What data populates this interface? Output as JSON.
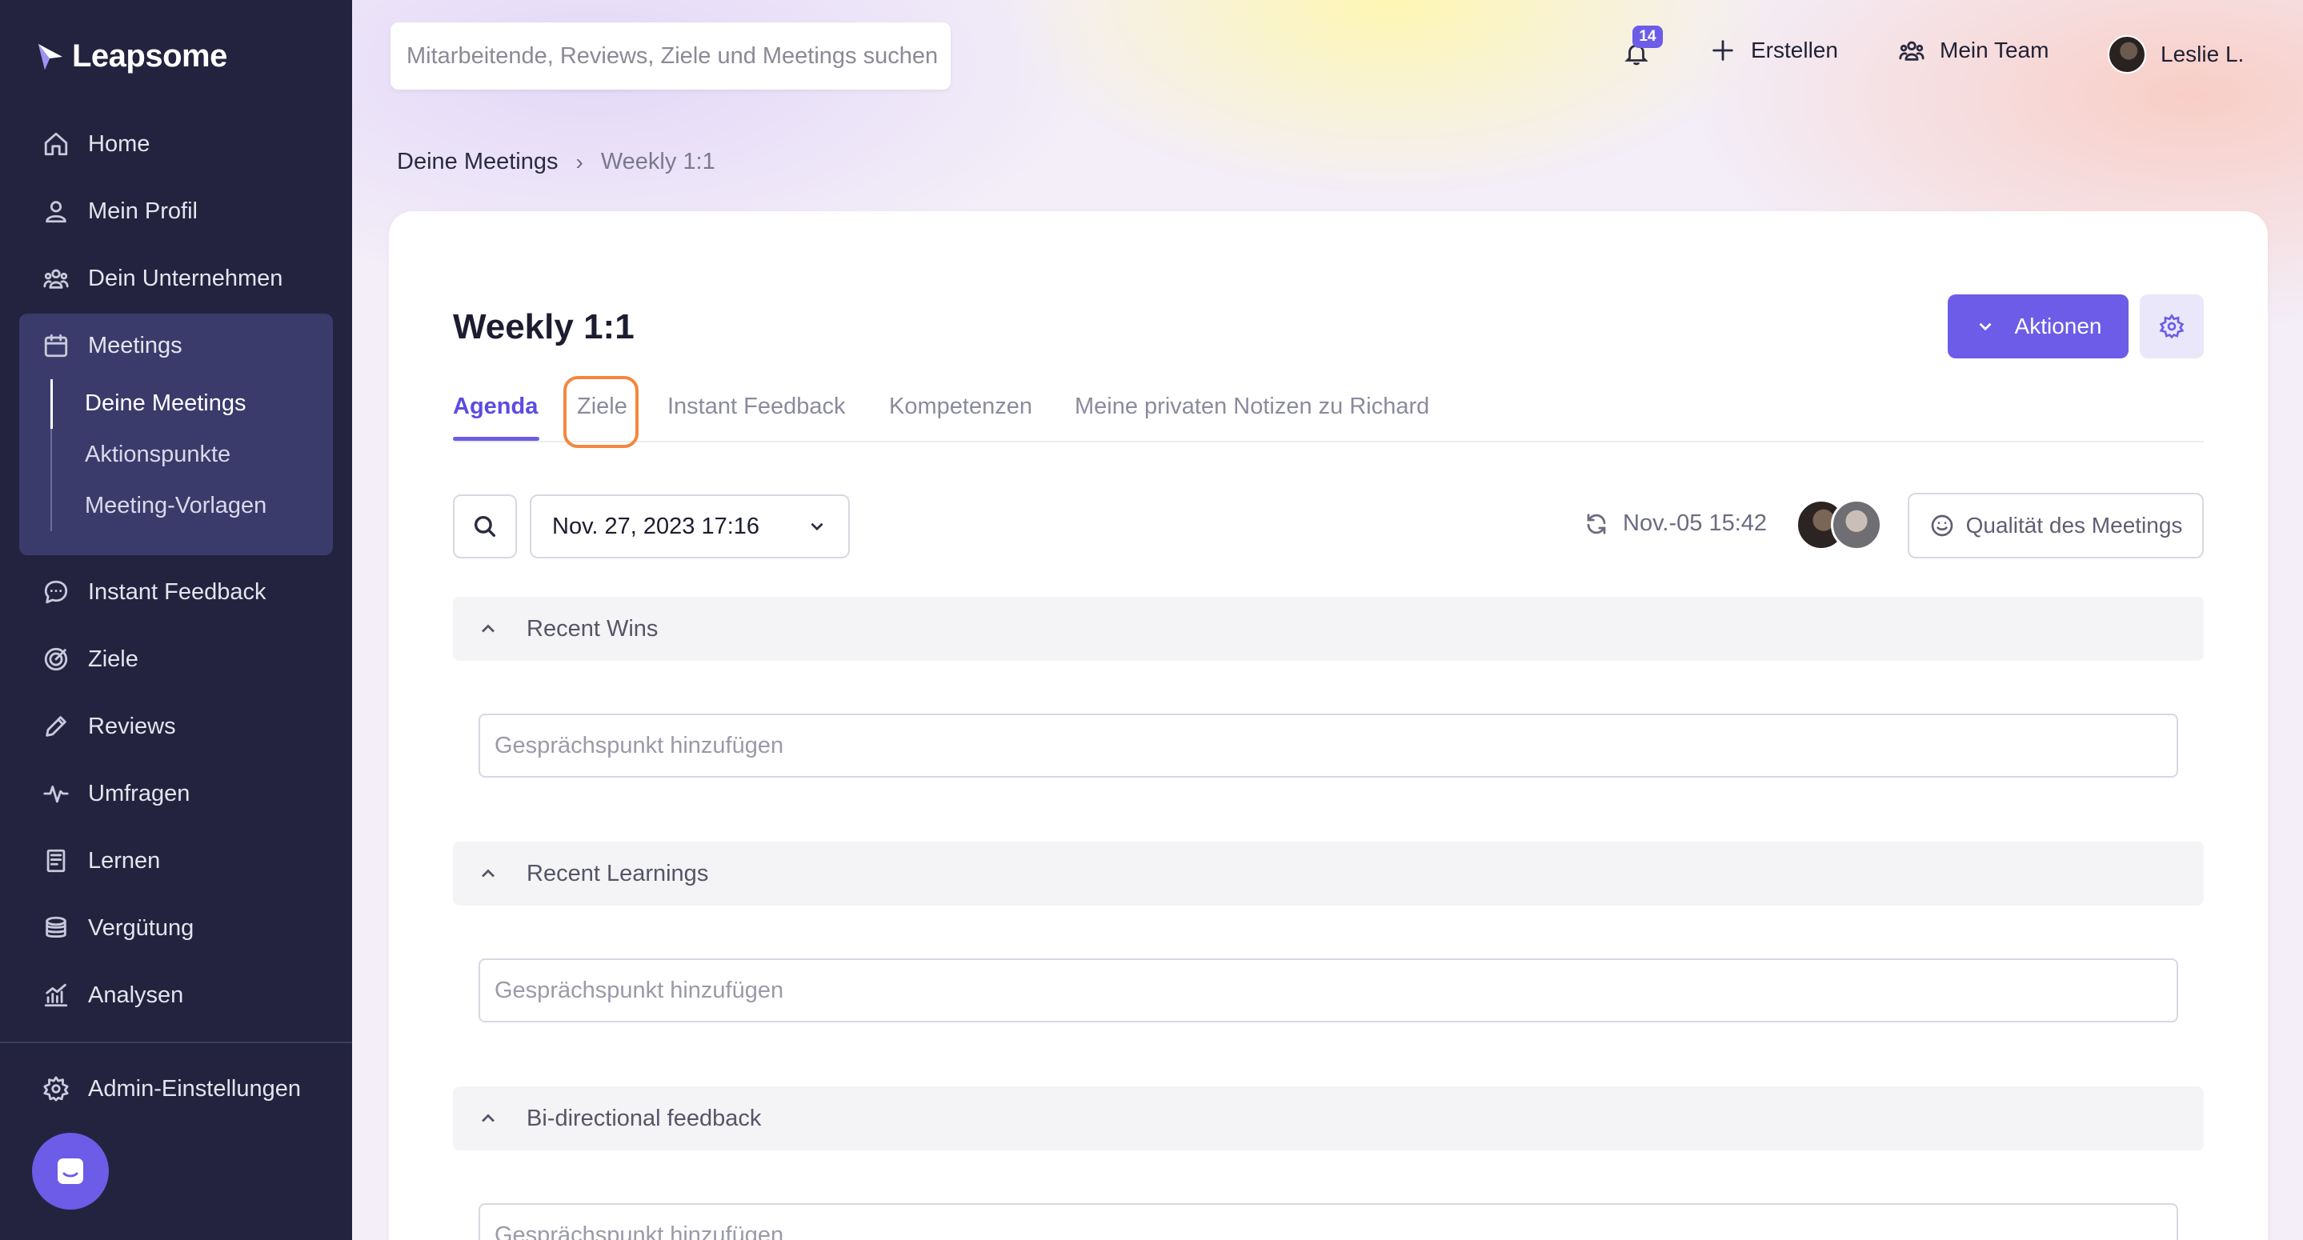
{
  "brand": {
    "name": "Leapsome",
    "accent": "#6c5ce7",
    "sidebar_bg": "#23233f"
  },
  "sidebar": {
    "items": [
      {
        "label": "Home",
        "icon": "home-icon"
      },
      {
        "label": "Mein Profil",
        "icon": "user-icon"
      },
      {
        "label": "Dein Unternehmen",
        "icon": "company-icon"
      },
      {
        "label": "Meetings",
        "icon": "calendar-icon"
      },
      {
        "label": "Instant Feedback",
        "icon": "chat-icon"
      },
      {
        "label": "Ziele",
        "icon": "target-icon"
      },
      {
        "label": "Reviews",
        "icon": "pencil-icon"
      },
      {
        "label": "Umfragen",
        "icon": "pulse-icon"
      },
      {
        "label": "Lernen",
        "icon": "book-icon"
      },
      {
        "label": "Vergütung",
        "icon": "coins-icon"
      },
      {
        "label": "Analysen",
        "icon": "analytics-icon"
      }
    ],
    "meetings_sub": [
      {
        "label": "Deine Meetings",
        "active": true
      },
      {
        "label": "Aktionspunkte",
        "active": false
      },
      {
        "label": "Meeting-Vorlagen",
        "active": false
      }
    ],
    "admin": {
      "label": "Admin-Einstellungen",
      "icon": "gear-icon"
    },
    "chat_icon": "messenger-icon"
  },
  "topbar": {
    "search_placeholder": "Mitarbeitende, Reviews, Ziele und Meetings suchen",
    "notifications_count": "14",
    "create_label": "Erstellen",
    "team_label": "Mein Team",
    "user_name": "Leslie L."
  },
  "breadcrumb": {
    "parent": "Deine Meetings",
    "current": "Weekly 1:1"
  },
  "meeting": {
    "title": "Weekly 1:1",
    "actions_label": "Aktionen",
    "tabs": [
      {
        "label": "Agenda",
        "active": true
      },
      {
        "label": "Ziele",
        "active": false,
        "highlighted": true
      },
      {
        "label": "Instant Feedback",
        "active": false
      },
      {
        "label": "Kompetenzen",
        "active": false
      },
      {
        "label": "Meine privaten Notizen zu Richard",
        "active": false
      }
    ],
    "date_selected": "Nov. 27, 2023 17:16",
    "last_sync": "Nov.-05 15:42",
    "quality_label": "Qualität des Meetings",
    "sections": [
      {
        "title": "Recent Wins",
        "input_placeholder": "Gesprächspunkt hinzufügen"
      },
      {
        "title": "Recent Learnings",
        "input_placeholder": "Gesprächspunkt hinzufügen"
      },
      {
        "title": "Bi-directional feedback",
        "input_placeholder": "Gesprächspunkt hinzufügen"
      }
    ]
  }
}
